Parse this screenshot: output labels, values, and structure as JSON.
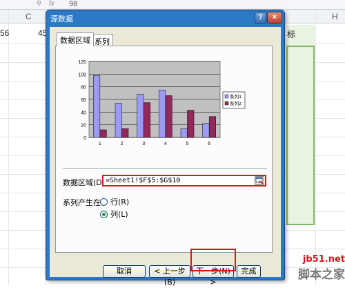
{
  "sheet": {
    "formula_value": "98",
    "fx_label": "fx",
    "zoom_icon": "magnifier-icon",
    "columns": [
      "C",
      "H"
    ],
    "cell_left": "56",
    "cell_b": "45",
    "cell_right": "标"
  },
  "dialog": {
    "title": "源数据",
    "help_label": "?",
    "close_label": "×",
    "tabs": [
      {
        "label": "数据区域",
        "active": true
      },
      {
        "label": "系列",
        "active": false
      }
    ],
    "range_label": "数据区域(D):",
    "range_value": "=Sheet1!$F$5:$G$10",
    "series_label": "系列产生在:",
    "series_options": [
      {
        "label": "行(R)",
        "selected": false
      },
      {
        "label": "列(L)",
        "selected": true
      }
    ],
    "buttons": {
      "cancel": "取消",
      "back": "< 上一步(B)",
      "next": "下一步(N) >",
      "finish": "完成"
    }
  },
  "chart_data": {
    "type": "bar",
    "categories": [
      "1",
      "2",
      "3",
      "4",
      "5",
      "6"
    ],
    "series": [
      {
        "name": "系列1",
        "values": [
          98,
          54,
          68,
          75,
          14,
          22
        ],
        "color": "#9b9bf5"
      },
      {
        "name": "系列2",
        "values": [
          12,
          14,
          55,
          66,
          43,
          33
        ],
        "color": "#93285a"
      }
    ],
    "yticks": [
      0,
      20,
      40,
      60,
      80,
      100,
      120
    ],
    "ylim": [
      0,
      120
    ],
    "plot_bg": "#c0c0c0",
    "legend": "right"
  },
  "watermark": {
    "top": "jb51.net",
    "bottom": "脚本之家"
  }
}
